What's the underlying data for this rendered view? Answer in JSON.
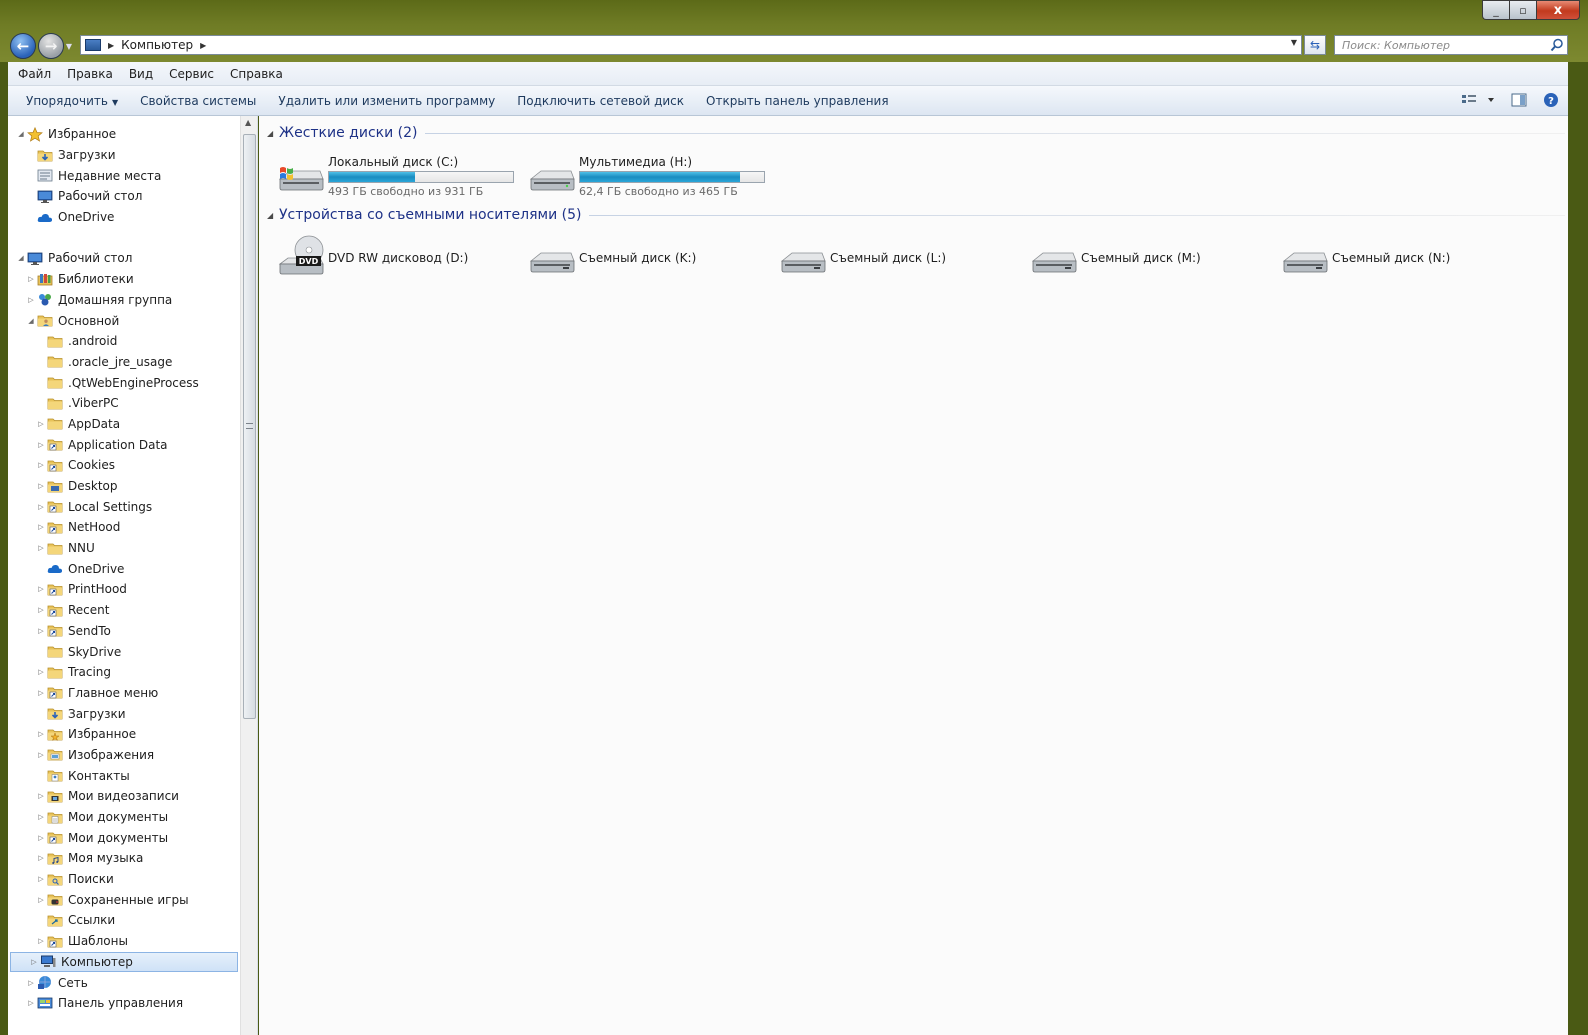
{
  "window": {
    "controls": {
      "minimize": "_",
      "maximize": "▫",
      "close": "x"
    }
  },
  "address": {
    "crumb": "Компьютер",
    "search_placeholder": "Поиск: Компьютер"
  },
  "menu": [
    "Файл",
    "Правка",
    "Вид",
    "Сервис",
    "Справка"
  ],
  "commands": {
    "organize": "Упорядочить",
    "system_props": "Свойства системы",
    "uninstall": "Удалить или изменить программу",
    "map_drive": "Подключить сетевой диск",
    "control_panel": "Открыть панель управления"
  },
  "nav": {
    "items": [
      {
        "label": "Избранное",
        "indent": 0,
        "expander": "open",
        "icon": "star-icon"
      },
      {
        "label": "Загрузки",
        "indent": 1,
        "expander": "none",
        "icon": "downloads-folder-icon"
      },
      {
        "label": "Недавние места",
        "indent": 1,
        "expander": "none",
        "icon": "recent-places-icon"
      },
      {
        "label": "Рабочий стол",
        "indent": 1,
        "expander": "none",
        "icon": "desktop-icon"
      },
      {
        "label": "OneDrive",
        "indent": 1,
        "expander": "none",
        "icon": "cloud-icon"
      },
      {
        "label": "",
        "indent": 0,
        "expander": "gap",
        "icon": ""
      },
      {
        "label": "Рабочий стол",
        "indent": 0,
        "expander": "open",
        "icon": "desktop-icon"
      },
      {
        "label": "Библиотеки",
        "indent": 1,
        "expander": "closed",
        "icon": "libraries-icon"
      },
      {
        "label": "Домашняя группа",
        "indent": 1,
        "expander": "closed",
        "icon": "homegroup-icon"
      },
      {
        "label": "Основной",
        "indent": 1,
        "expander": "open",
        "icon": "user-folder-icon"
      },
      {
        "label": ".android",
        "indent": 2,
        "expander": "none",
        "icon": "folder-icon"
      },
      {
        "label": ".oracle_jre_usage",
        "indent": 2,
        "expander": "none",
        "icon": "folder-icon"
      },
      {
        "label": ".QtWebEngineProcess",
        "indent": 2,
        "expander": "none",
        "icon": "folder-icon"
      },
      {
        "label": ".ViberPC",
        "indent": 2,
        "expander": "none",
        "icon": "folder-icon"
      },
      {
        "label": "AppData",
        "indent": 2,
        "expander": "closed",
        "icon": "folder-icon"
      },
      {
        "label": "Application Data",
        "indent": 2,
        "expander": "closed",
        "icon": "shortcut-folder-icon"
      },
      {
        "label": "Cookies",
        "indent": 2,
        "expander": "closed",
        "icon": "shortcut-folder-icon"
      },
      {
        "label": "Desktop",
        "indent": 2,
        "expander": "closed",
        "icon": "desktop-folder-icon"
      },
      {
        "label": "Local Settings",
        "indent": 2,
        "expander": "closed",
        "icon": "shortcut-folder-icon"
      },
      {
        "label": "NetHood",
        "indent": 2,
        "expander": "closed",
        "icon": "shortcut-folder-icon"
      },
      {
        "label": "NNU",
        "indent": 2,
        "expander": "closed",
        "icon": "folder-icon"
      },
      {
        "label": "OneDrive",
        "indent": 2,
        "expander": "none",
        "icon": "cloud-icon"
      },
      {
        "label": "PrintHood",
        "indent": 2,
        "expander": "closed",
        "icon": "shortcut-folder-icon"
      },
      {
        "label": "Recent",
        "indent": 2,
        "expander": "closed",
        "icon": "shortcut-folder-icon"
      },
      {
        "label": "SendTo",
        "indent": 2,
        "expander": "closed",
        "icon": "shortcut-folder-icon"
      },
      {
        "label": "SkyDrive",
        "indent": 2,
        "expander": "none",
        "icon": "folder-icon"
      },
      {
        "label": "Tracing",
        "indent": 2,
        "expander": "closed",
        "icon": "folder-icon"
      },
      {
        "label": "Главное меню",
        "indent": 2,
        "expander": "closed",
        "icon": "shortcut-folder-icon"
      },
      {
        "label": "Загрузки",
        "indent": 2,
        "expander": "none",
        "icon": "downloads-folder-icon"
      },
      {
        "label": "Избранное",
        "indent": 2,
        "expander": "closed",
        "icon": "favorites-folder-icon"
      },
      {
        "label": "Изображения",
        "indent": 2,
        "expander": "closed",
        "icon": "pictures-folder-icon"
      },
      {
        "label": "Контакты",
        "indent": 2,
        "expander": "none",
        "icon": "contacts-folder-icon"
      },
      {
        "label": "Мои видеозаписи",
        "indent": 2,
        "expander": "closed",
        "icon": "videos-folder-icon"
      },
      {
        "label": "Мои документы",
        "indent": 2,
        "expander": "closed",
        "icon": "documents-folder-icon"
      },
      {
        "label": "Мои документы",
        "indent": 2,
        "expander": "closed",
        "icon": "shortcut-folder-icon"
      },
      {
        "label": "Моя музыка",
        "indent": 2,
        "expander": "closed",
        "icon": "music-folder-icon"
      },
      {
        "label": "Поиски",
        "indent": 2,
        "expander": "closed",
        "icon": "searches-folder-icon"
      },
      {
        "label": "Сохраненные игры",
        "indent": 2,
        "expander": "closed",
        "icon": "games-folder-icon"
      },
      {
        "label": "Ссылки",
        "indent": 2,
        "expander": "none",
        "icon": "links-folder-icon"
      },
      {
        "label": "Шаблоны",
        "indent": 2,
        "expander": "closed",
        "icon": "shortcut-folder-icon"
      },
      {
        "label": "Компьютер",
        "indent": 1,
        "expander": "closed",
        "icon": "computer-icon",
        "selected": true
      },
      {
        "label": "Сеть",
        "indent": 1,
        "expander": "closed",
        "icon": "network-icon"
      },
      {
        "label": "Панель управления",
        "indent": 1,
        "expander": "closed",
        "icon": "control-panel-icon"
      }
    ]
  },
  "groups": {
    "hard_disks": "Жесткие диски (2)",
    "removable": "Устройства со съемными носителями (5)"
  },
  "hard_drives": [
    {
      "name": "Локальный диск (C:)",
      "free": "493 ГБ свободно из 931 ГБ",
      "used_fraction": 0.47,
      "icon": "windows-drive-icon"
    },
    {
      "name": "Мультимедиа (H:)",
      "free": "62,4 ГБ свободно из 465 ГБ",
      "used_fraction": 0.87,
      "icon": "hard-drive-icon"
    }
  ],
  "removable_drives": [
    {
      "name": "DVD RW дисковод (D:)",
      "icon": "dvd-drive-icon"
    },
    {
      "name": "Съемный диск (K:)",
      "icon": "removable-drive-icon"
    },
    {
      "name": "Съемный диск (L:)",
      "icon": "removable-drive-icon"
    },
    {
      "name": "Съемный диск (M:)",
      "icon": "removable-drive-icon"
    },
    {
      "name": "Съемный диск (N:)",
      "icon": "removable-drive-icon"
    }
  ],
  "colors": {
    "accent_bar": "#1a8cc0",
    "group_title": "#1e3287",
    "selection": "#cfe2f7"
  }
}
